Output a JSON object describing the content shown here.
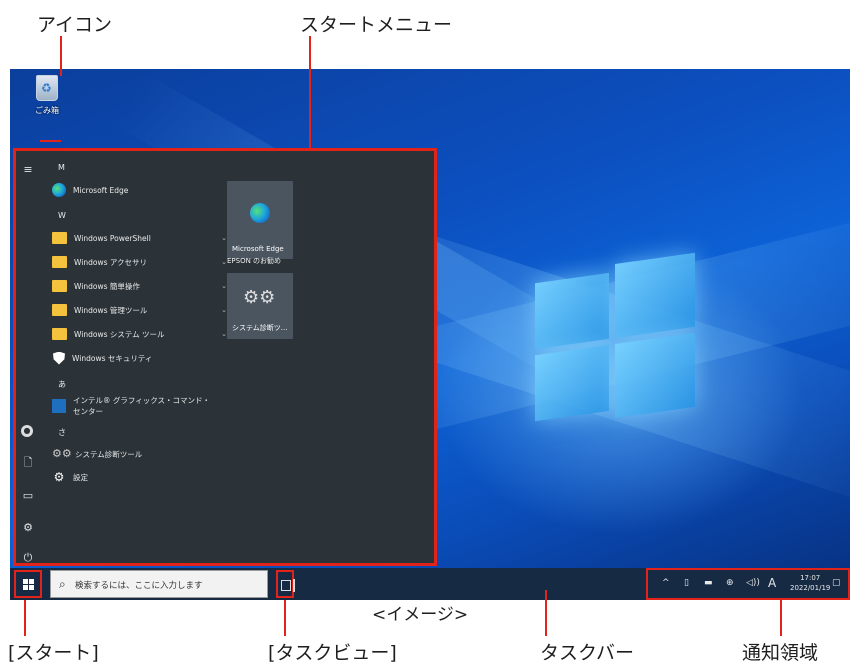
{
  "annotations": {
    "icon": "アイコン",
    "start_menu": "スタートメニュー",
    "start": "[スタート]",
    "task_view": "[タスクビュー]",
    "taskbar": "タスクバー",
    "notification_area": "通知領域",
    "image_note": "<イメージ>"
  },
  "desktop": {
    "recycle_bin_label": "ごみ箱"
  },
  "start_menu": {
    "letters": {
      "m": "M",
      "w": "W",
      "a": "あ",
      "sa": "さ"
    },
    "apps": {
      "edge": "Microsoft Edge",
      "powershell": "Windows PowerShell",
      "accessories": "Windows アクセサリ",
      "ease_of_access": "Windows 簡単操作",
      "admin_tools": "Windows 管理ツール",
      "system_tools": "Windows システム ツール",
      "security": "Windows セキュリティ",
      "intel": "インテル® グラフィックス・コマンド・センター",
      "diag": "システム診断ツール",
      "settings": "設定"
    },
    "tiles": {
      "edge": "Microsoft Edge",
      "group": "EPSON のお勧め",
      "diag": "システム診断ツ..."
    }
  },
  "taskbar": {
    "search_placeholder": "検索するには、ここに入力します",
    "tray": {
      "ime": "A",
      "time": "17:07",
      "date": "2022/01/19"
    }
  },
  "colors": {
    "annotation_red": "#e2231a",
    "start_menu_bg": "#2b3338",
    "taskbar_bg": "#172a44",
    "folder": "#f4c23d"
  }
}
